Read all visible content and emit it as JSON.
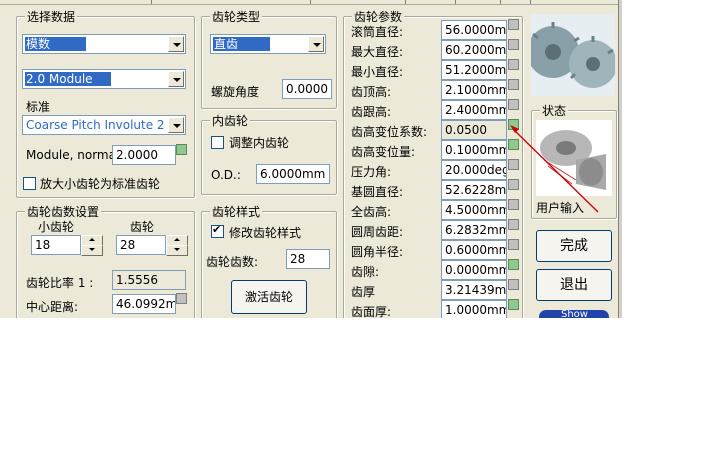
{
  "select_data": {
    "title": "选择数据",
    "combo1": "模数",
    "combo2": "2.0 Module",
    "standard_label": "标准",
    "combo3": "Coarse Pitch Involute 20 deg",
    "module_normal_label": "Module, normal:",
    "module_normal_value": "2.0000",
    "scale_checkbox_label": "放大小齿轮为标准齿轮"
  },
  "gear_type": {
    "title": "齿轮类型",
    "combo": "直齿",
    "helix_label": "螺旋角度",
    "helix_value": "0.0000"
  },
  "internal_gear": {
    "title": "内齿轮",
    "adjust_label": "调整内齿轮",
    "od_label": "O.D.:",
    "od_value": "6.0000mm"
  },
  "tooth_count": {
    "title": "齿轮齿数设置",
    "pinion_label": "小齿轮",
    "gear_label": "齿轮",
    "pinion_value": "18",
    "gear_value": "28",
    "ratio_label": "齿轮比率 1 :",
    "ratio_value": "1.5556",
    "center_label": "中心距离:",
    "center_value": "46.0992mm"
  },
  "gear_style": {
    "title": "齿轮样式",
    "modify_label": "修改齿轮样式",
    "teeth_label": "齿轮齿数:",
    "teeth_value": "28",
    "activate_button": "激活齿轮"
  },
  "params": {
    "title": "齿轮参数",
    "rows": [
      {
        "label": "滚筒直径:",
        "value": "56.0000mm"
      },
      {
        "label": "最大直径:",
        "value": "60.2000mm"
      },
      {
        "label": "最小直径:",
        "value": "51.2000mm"
      },
      {
        "label": "齿顶高:",
        "value": "2.1000mm"
      },
      {
        "label": "齿跟高:",
        "value": "2.4000mm"
      },
      {
        "label": "齿高变位系数:",
        "value": "0.0500"
      },
      {
        "label": "齿高变位量:",
        "value": "0.1000mm"
      },
      {
        "label": "压力角:",
        "value": "20.000deg"
      },
      {
        "label": "基圆直径:",
        "value": "52.6228mm"
      },
      {
        "label": "全齿高:",
        "value": "4.5000mm"
      },
      {
        "label": "圆周齿距:",
        "value": "6.2832mm"
      },
      {
        "label": "圆角半径:",
        "value": "0.6000mm"
      },
      {
        "label": "齿隙:",
        "value": "0.0000mm"
      },
      {
        "label": "齿厚",
        "value": "3.21439mm"
      },
      {
        "label": "齿面厚:",
        "value": "1.0000mm"
      }
    ]
  },
  "status": {
    "title": "状态",
    "user_input": "用户输入"
  },
  "buttons": {
    "finish": "完成",
    "exit": "退出",
    "show": "Show"
  },
  "colors": {
    "dialog_bg": "#ece9d8",
    "selection": "#316ac5",
    "arrow": "#cc0000",
    "indicator_green": "#90c890"
  }
}
